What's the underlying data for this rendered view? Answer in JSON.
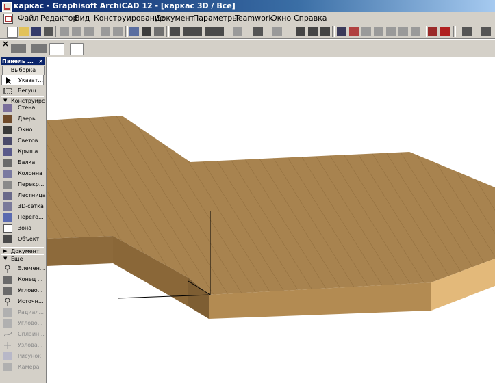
{
  "window": {
    "title": "каркас - Graphisoft ArchiCAD 12 - [каркас 3D / Все]"
  },
  "menu": [
    "Файл",
    "Редактор",
    "Вид",
    "Конструирование",
    "Документ",
    "Параметры",
    "Teamwork",
    "Окно",
    "Справка"
  ],
  "toolbox": {
    "title": "Панель ...",
    "close": "×",
    "selection_header": "Выборка",
    "selection_tools": [
      {
        "label": "Указат...",
        "icon": "arrow-pointer-icon"
      },
      {
        "label": "Бегущ...",
        "icon": "marquee-icon"
      }
    ],
    "design_section": "Конструирс",
    "design_tools": [
      {
        "label": "Стена",
        "icon": "wall-icon"
      },
      {
        "label": "Дверь",
        "icon": "door-icon"
      },
      {
        "label": "Окно",
        "icon": "window-icon"
      },
      {
        "label": "Светов...",
        "icon": "skylight-icon"
      },
      {
        "label": "Крыша",
        "icon": "roof-icon"
      },
      {
        "label": "Балка",
        "icon": "beam-icon"
      },
      {
        "label": "Колонна",
        "icon": "column-icon"
      },
      {
        "label": "Перекр...",
        "icon": "slab-icon"
      },
      {
        "label": "Лестница",
        "icon": "stair-icon"
      },
      {
        "label": "3D-сетка",
        "icon": "mesh-icon"
      },
      {
        "label": "Перего...",
        "icon": "curtain-wall-icon"
      },
      {
        "label": "Зона",
        "icon": "zone-icon"
      },
      {
        "label": "Объект",
        "icon": "object-icon"
      }
    ],
    "document_section": "Документ",
    "more_section": "Еще",
    "more_tools": [
      {
        "label": "Элемен...",
        "icon": "element-icon",
        "enabled": true
      },
      {
        "label": "Конец ...",
        "icon": "end-icon",
        "enabled": true
      },
      {
        "label": "Углово...",
        "icon": "corner-icon",
        "enabled": true
      },
      {
        "label": "Источн...",
        "icon": "light-source-icon",
        "enabled": true
      },
      {
        "label": "Радиал...",
        "icon": "radial-icon",
        "enabled": false
      },
      {
        "label": "Углово...",
        "icon": "angle-icon",
        "enabled": false
      },
      {
        "label": "Сплайн...",
        "icon": "spline-icon",
        "enabled": false
      },
      {
        "label": "Узлова...",
        "icon": "hotspot-icon",
        "enabled": false
      },
      {
        "label": "Рисунок",
        "icon": "picture-icon",
        "enabled": false
      },
      {
        "label": "Камера",
        "icon": "camera-icon",
        "enabled": false
      }
    ]
  },
  "colors": {
    "slab_top": "#a8834f",
    "slab_side": "#8d6a3b",
    "slab_front": "#b38b52",
    "slab_light": "#e3b97a",
    "title_blue": "#0a246a"
  }
}
